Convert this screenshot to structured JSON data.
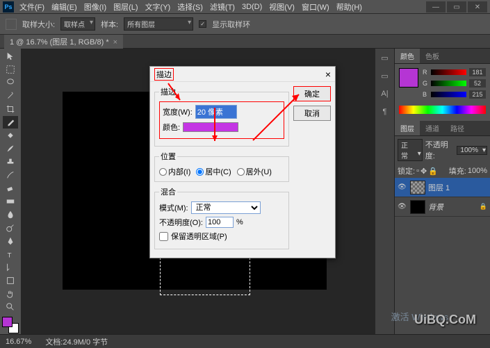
{
  "menu": {
    "items": [
      "文件(F)",
      "编辑(E)",
      "图像(I)",
      "图层(L)",
      "文字(Y)",
      "选择(S)",
      "滤镜(T)",
      "3D(D)",
      "视图(V)",
      "窗口(W)",
      "帮助(H)"
    ]
  },
  "optbar": {
    "label1": "取样大小:",
    "sel1": "取样点",
    "label2": "样本:",
    "sel2": "所有图层",
    "chk_label": "显示取样环"
  },
  "doc_tab": "1 @ 16.7% (图层 1, RGB/8) *",
  "dialog": {
    "title": "描边",
    "fs1": "描边",
    "width_label": "宽度(W):",
    "width_val": "20 像素",
    "color_label": "颜色:",
    "fs2": "位置",
    "r1": "内部(I)",
    "r2": "居中(C)",
    "r3": "居外(U)",
    "fs3": "混合",
    "mode_label": "模式(M):",
    "mode_val": "正常",
    "opacity_label": "不透明度(O):",
    "opacity_val": "100",
    "opacity_unit": "%",
    "preserve": "保留透明区域(P)",
    "ok": "确定",
    "cancel": "取消"
  },
  "color": {
    "tab1": "颜色",
    "tab2": "色板",
    "r": "R",
    "g": "G",
    "b": "B",
    "rv": "181",
    "gv": "52",
    "bv": "215"
  },
  "layers": {
    "tab1": "图层",
    "tab2": "通道",
    "tab3": "路径",
    "blend": "正常",
    "opacity_label": "不透明度:",
    "opacity": "100%",
    "lock_label": "锁定:",
    "fill_label": "填充:",
    "fill": "100%",
    "l1": "图层 1",
    "l2": "背景"
  },
  "status": {
    "zoom": "16.67%",
    "doc": "文档:24.9M/0 字节"
  },
  "watermark": "激活 Windows",
  "watermark2": "UiBQ.CoM"
}
